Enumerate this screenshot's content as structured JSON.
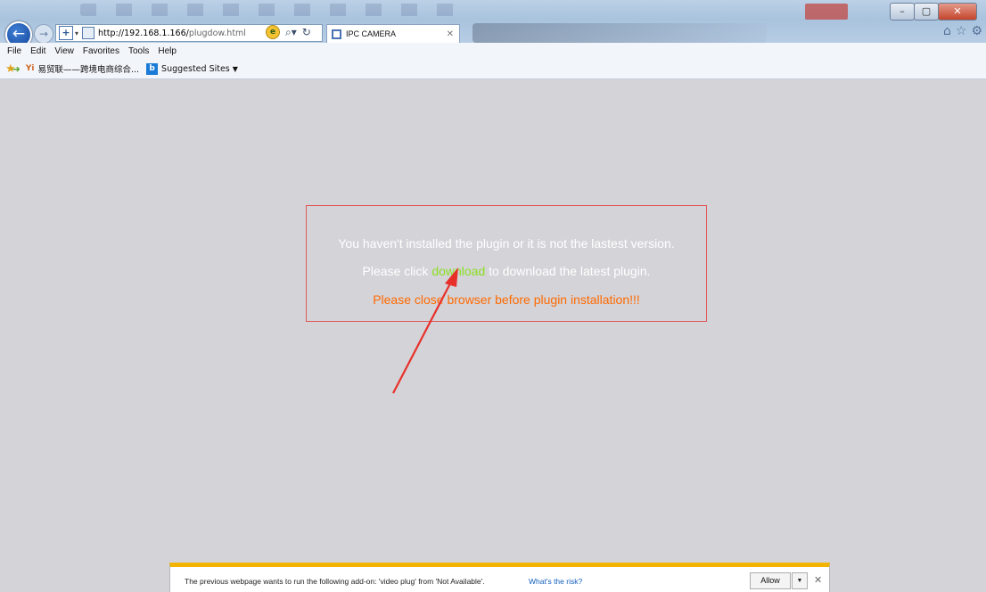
{
  "browser": {
    "address_url_host": "http://192.168.1.166/",
    "address_url_path": "plugdow.html",
    "tab_title": "IPC CAMERA",
    "window_controls": [
      "–",
      "▢",
      "✕"
    ]
  },
  "menu": [
    "File",
    "Edit",
    "View",
    "Favorites",
    "Tools",
    "Help"
  ],
  "favorites": {
    "item1": "易贸联——跨境电商综合...",
    "item2": "Suggested Sites"
  },
  "notice": {
    "line1": "You haven't installed the plugin or it is not the lastest version.",
    "line2_prefix": "Please click ",
    "line2_link": "download",
    "line2_suffix": " to download the latest plugin.",
    "line3": "Please close browser before plugin installation!!!"
  },
  "notification_bar": {
    "message": "The previous webpage wants to run the following add-on: 'video plug' from 'Not Available'.",
    "risk_link": "What's the risk?",
    "allow_label": "Allow"
  },
  "colors": {
    "page_bg": "#d4d3d8",
    "notice_border": "#e05a5a",
    "download_link": "#8be022",
    "warning_text": "#ff6a00",
    "notif_accent": "#f2b400",
    "arrow": "#e8302a"
  }
}
